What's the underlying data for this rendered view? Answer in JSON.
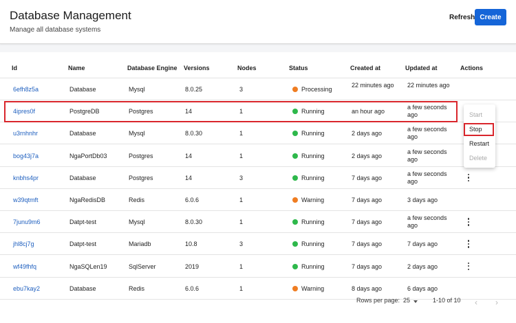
{
  "header": {
    "title": "Database Management",
    "subtitle": "Manage all database systems",
    "refresh_label": "Refresh",
    "create_label": "Create"
  },
  "table": {
    "columns": [
      "Id",
      "Name",
      "Database Engine",
      "Versions",
      "Nodes",
      "Status",
      "Created at",
      "Updated at",
      "Actions"
    ],
    "rows": [
      {
        "id": "6efh8z5a",
        "name": "Database",
        "engine": "Mysql",
        "version": "8.0.25",
        "nodes": "3",
        "status": "Processing",
        "created": "22 minutes ago",
        "updated": "22 minutes ago"
      },
      {
        "id": "4ipres0f",
        "name": "PostgreDB",
        "engine": "Postgres",
        "version": "14",
        "nodes": "1",
        "status": "Running",
        "created": "an hour ago",
        "updated": "a few seconds ago"
      },
      {
        "id": "u3rnhnhr",
        "name": "Database",
        "engine": "Mysql",
        "version": "8.0.30",
        "nodes": "1",
        "status": "Running",
        "created": "2 days ago",
        "updated": "a few seconds ago"
      },
      {
        "id": "bog43j7a",
        "name": "NgaPortDb03",
        "engine": "Postgres",
        "version": "14",
        "nodes": "1",
        "status": "Running",
        "created": "2 days ago",
        "updated": "a few seconds ago"
      },
      {
        "id": "knbhs4pr",
        "name": "Database",
        "engine": "Postgres",
        "version": "14",
        "nodes": "3",
        "status": "Running",
        "created": "7 days ago",
        "updated": "a few seconds ago"
      },
      {
        "id": "w39qtmft",
        "name": "NgaRedisDB",
        "engine": "Redis",
        "version": "6.0.6",
        "nodes": "1",
        "status": "Warning",
        "created": "7 days ago",
        "updated": "3 days ago"
      },
      {
        "id": "7junu9m6",
        "name": "Datpt-test",
        "engine": "Mysql",
        "version": "8.0.30",
        "nodes": "1",
        "status": "Running",
        "created": "7 days ago",
        "updated": "a few seconds ago"
      },
      {
        "id": "jhl8cj7g",
        "name": "Datpt-test",
        "engine": "Mariadb",
        "version": "10.8",
        "nodes": "3",
        "status": "Running",
        "created": "7 days ago",
        "updated": "7 days ago"
      },
      {
        "id": "wf49fhfq",
        "name": "NgaSQLen19",
        "engine": "SqlServer",
        "version": "2019",
        "nodes": "1",
        "status": "Running",
        "created": "7 days ago",
        "updated": "2 days ago"
      },
      {
        "id": "ebu7kay2",
        "name": "Database",
        "engine": "Redis",
        "version": "6.0.6",
        "nodes": "1",
        "status": "Warning",
        "created": "8 days ago",
        "updated": "6 days ago"
      }
    ]
  },
  "status_colors": {
    "Processing": "#ef7d22",
    "Running": "#2eb84b",
    "Warning": "#ef7d22"
  },
  "context_menu": {
    "start": "Start",
    "stop": "Stop",
    "restart": "Restart",
    "delete": "Delete"
  },
  "pagination": {
    "rows_per_page_label": "Rows per page:",
    "rows_per_page_value": "25",
    "range": "1-10 of 10",
    "prev_icon": "chevron-left-icon",
    "next_icon": "chevron-right-icon"
  }
}
